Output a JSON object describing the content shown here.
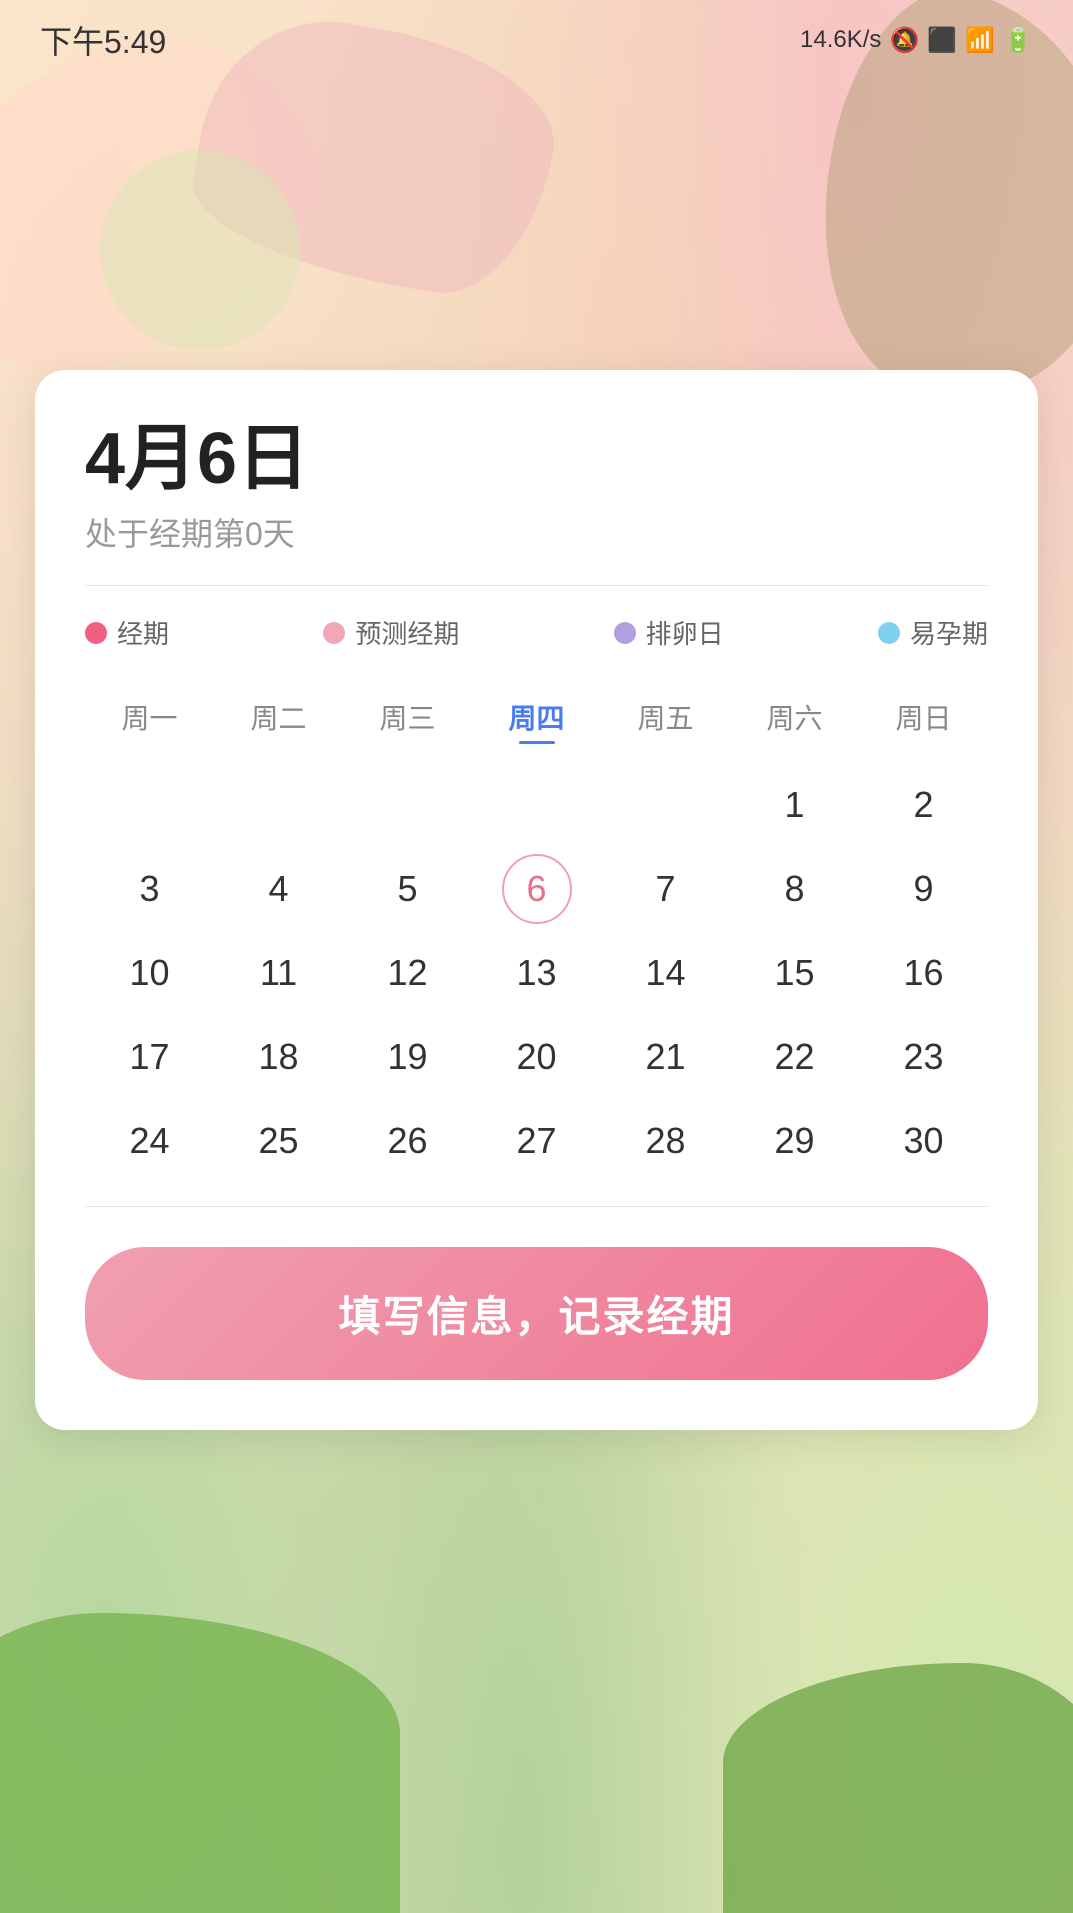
{
  "statusBar": {
    "time": "下午5:49",
    "network": "14.6K/s",
    "battery": "98"
  },
  "card": {
    "date": "4月6日",
    "subtitle": "处于经期第0天",
    "legend": [
      {
        "id": "period",
        "color": "#f06080",
        "label": "经期"
      },
      {
        "id": "predicted",
        "color": "#f0a8b8",
        "label": "预测经期"
      },
      {
        "id": "ovulation",
        "color": "#b0a0e0",
        "label": "排卵日"
      },
      {
        "id": "fertile",
        "color": "#80d0f0",
        "label": "易孕期"
      }
    ],
    "weekdays": [
      "周一",
      "周二",
      "周三",
      "周四",
      "周五",
      "周六",
      "周日"
    ],
    "activeWeekday": 3,
    "calendarDays": [
      "",
      "",
      "",
      "",
      "",
      "1",
      "2",
      "3",
      "4",
      "5",
      "6",
      "7",
      "8",
      "9",
      "10",
      "11",
      "12",
      "13",
      "14",
      "15",
      "16",
      "17",
      "18",
      "19",
      "20",
      "21",
      "22",
      "23",
      "24",
      "25",
      "26",
      "27",
      "28",
      "29",
      "30"
    ],
    "selectedDay": "6",
    "ctaButton": "填写信息，记录经期"
  }
}
